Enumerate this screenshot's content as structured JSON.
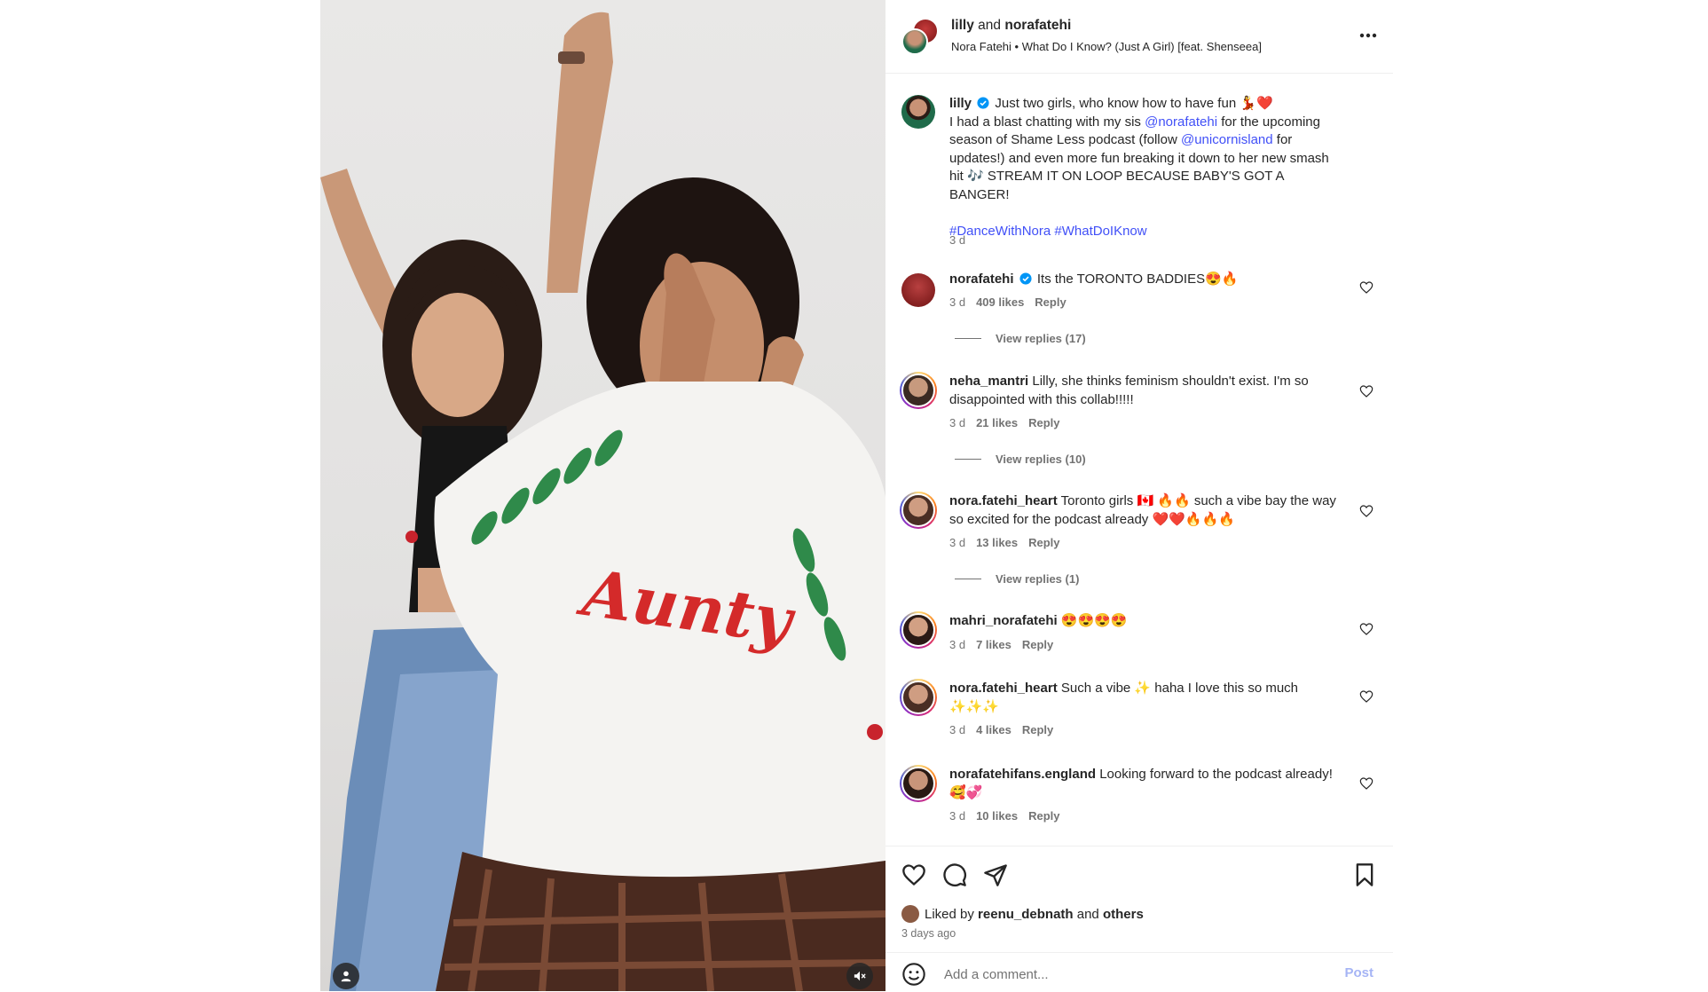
{
  "post": {
    "media": {
      "shirt_text": "Aunty"
    },
    "header": {
      "user1": "lilly",
      "joiner": "and",
      "user2": "norafatehi",
      "song": "Nora Fatehi • What Do I Know? (Just A Girl) [feat. Shenseea]"
    },
    "caption": {
      "username": "lilly",
      "line1": "Just two girls, who know how to have fun 💃❤️",
      "text_a": "I had a blast chatting with my sis",
      "mention1": "@norafatehi",
      "text_b": "for the upcoming season of Shame Less podcast (follow",
      "mention2": "@unicornisland",
      "text_c": "for updates!) and even more fun breaking it down to her new smash hit 🎶 STREAM IT ON LOOP BECAUSE BABY'S GOT A BANGER!",
      "hashtag1": "#DanceWithNora",
      "hashtag2": "#WhatDoIKnow",
      "time": "3 d"
    },
    "comments": [
      {
        "user": "norafatehi",
        "text": "Its the TORONTO BADDIES😍🔥",
        "time": "3 d",
        "likes": "409 likes",
        "reply": "Reply",
        "view_replies": "View replies (17)"
      },
      {
        "user": "neha_mantri",
        "text": "Lilly, she thinks feminism shouldn't exist. I'm so disappointed with this collab!!!!!",
        "time": "3 d",
        "likes": "21 likes",
        "reply": "Reply",
        "view_replies": "View replies (10)"
      },
      {
        "user": "nora.fatehi_heart",
        "text": "Toronto girls 🇨🇦 🔥🔥 such a vibe bay the way so excited for the podcast already ❤️❤️🔥🔥🔥",
        "time": "3 d",
        "likes": "13 likes",
        "reply": "Reply",
        "view_replies": "View replies (1)"
      },
      {
        "user": "mahri_norafatehi",
        "text": "😍😍😍😍",
        "time": "3 d",
        "likes": "7 likes",
        "reply": "Reply"
      },
      {
        "user": "nora.fatehi_heart",
        "text": "Such a vibe ✨ haha I love this so much ✨✨✨",
        "time": "3 d",
        "likes": "4 likes",
        "reply": "Reply"
      },
      {
        "user": "norafatehifans.england",
        "text": "Looking forward to the podcast already! 🥰💞",
        "time": "3 d",
        "likes": "10 likes",
        "reply": "Reply"
      }
    ],
    "likes": {
      "prefix": "Liked by",
      "user": "reenu_debnath",
      "joiner": "and",
      "others": "others",
      "ago": "3 days ago"
    },
    "add_comment": {
      "placeholder": "Add a comment...",
      "post_label": "Post"
    }
  },
  "colors": {
    "link": "#4150f7",
    "muted": "#737373",
    "verified": "#0095f6",
    "post_disabled": "#a5b4f5"
  },
  "icons": [
    "more-icon",
    "verified-icon",
    "heart-icon",
    "comment-icon",
    "share-icon",
    "bookmark-icon",
    "emoji-icon",
    "user-tag-icon",
    "muted-speaker-icon"
  ]
}
